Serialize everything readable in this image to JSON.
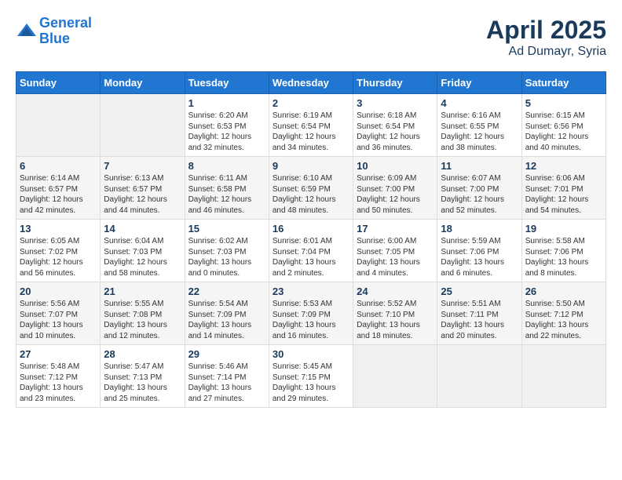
{
  "header": {
    "logo_line1": "General",
    "logo_line2": "Blue",
    "month": "April 2025",
    "location": "Ad Dumayr, Syria"
  },
  "days_of_week": [
    "Sunday",
    "Monday",
    "Tuesday",
    "Wednesday",
    "Thursday",
    "Friday",
    "Saturday"
  ],
  "weeks": [
    [
      {
        "day": null,
        "info": null
      },
      {
        "day": null,
        "info": null
      },
      {
        "day": "1",
        "info": "Sunrise: 6:20 AM\nSunset: 6:53 PM\nDaylight: 12 hours\nand 32 minutes."
      },
      {
        "day": "2",
        "info": "Sunrise: 6:19 AM\nSunset: 6:54 PM\nDaylight: 12 hours\nand 34 minutes."
      },
      {
        "day": "3",
        "info": "Sunrise: 6:18 AM\nSunset: 6:54 PM\nDaylight: 12 hours\nand 36 minutes."
      },
      {
        "day": "4",
        "info": "Sunrise: 6:16 AM\nSunset: 6:55 PM\nDaylight: 12 hours\nand 38 minutes."
      },
      {
        "day": "5",
        "info": "Sunrise: 6:15 AM\nSunset: 6:56 PM\nDaylight: 12 hours\nand 40 minutes."
      }
    ],
    [
      {
        "day": "6",
        "info": "Sunrise: 6:14 AM\nSunset: 6:57 PM\nDaylight: 12 hours\nand 42 minutes."
      },
      {
        "day": "7",
        "info": "Sunrise: 6:13 AM\nSunset: 6:57 PM\nDaylight: 12 hours\nand 44 minutes."
      },
      {
        "day": "8",
        "info": "Sunrise: 6:11 AM\nSunset: 6:58 PM\nDaylight: 12 hours\nand 46 minutes."
      },
      {
        "day": "9",
        "info": "Sunrise: 6:10 AM\nSunset: 6:59 PM\nDaylight: 12 hours\nand 48 minutes."
      },
      {
        "day": "10",
        "info": "Sunrise: 6:09 AM\nSunset: 7:00 PM\nDaylight: 12 hours\nand 50 minutes."
      },
      {
        "day": "11",
        "info": "Sunrise: 6:07 AM\nSunset: 7:00 PM\nDaylight: 12 hours\nand 52 minutes."
      },
      {
        "day": "12",
        "info": "Sunrise: 6:06 AM\nSunset: 7:01 PM\nDaylight: 12 hours\nand 54 minutes."
      }
    ],
    [
      {
        "day": "13",
        "info": "Sunrise: 6:05 AM\nSunset: 7:02 PM\nDaylight: 12 hours\nand 56 minutes."
      },
      {
        "day": "14",
        "info": "Sunrise: 6:04 AM\nSunset: 7:03 PM\nDaylight: 12 hours\nand 58 minutes."
      },
      {
        "day": "15",
        "info": "Sunrise: 6:02 AM\nSunset: 7:03 PM\nDaylight: 13 hours\nand 0 minutes."
      },
      {
        "day": "16",
        "info": "Sunrise: 6:01 AM\nSunset: 7:04 PM\nDaylight: 13 hours\nand 2 minutes."
      },
      {
        "day": "17",
        "info": "Sunrise: 6:00 AM\nSunset: 7:05 PM\nDaylight: 13 hours\nand 4 minutes."
      },
      {
        "day": "18",
        "info": "Sunrise: 5:59 AM\nSunset: 7:06 PM\nDaylight: 13 hours\nand 6 minutes."
      },
      {
        "day": "19",
        "info": "Sunrise: 5:58 AM\nSunset: 7:06 PM\nDaylight: 13 hours\nand 8 minutes."
      }
    ],
    [
      {
        "day": "20",
        "info": "Sunrise: 5:56 AM\nSunset: 7:07 PM\nDaylight: 13 hours\nand 10 minutes."
      },
      {
        "day": "21",
        "info": "Sunrise: 5:55 AM\nSunset: 7:08 PM\nDaylight: 13 hours\nand 12 minutes."
      },
      {
        "day": "22",
        "info": "Sunrise: 5:54 AM\nSunset: 7:09 PM\nDaylight: 13 hours\nand 14 minutes."
      },
      {
        "day": "23",
        "info": "Sunrise: 5:53 AM\nSunset: 7:09 PM\nDaylight: 13 hours\nand 16 minutes."
      },
      {
        "day": "24",
        "info": "Sunrise: 5:52 AM\nSunset: 7:10 PM\nDaylight: 13 hours\nand 18 minutes."
      },
      {
        "day": "25",
        "info": "Sunrise: 5:51 AM\nSunset: 7:11 PM\nDaylight: 13 hours\nand 20 minutes."
      },
      {
        "day": "26",
        "info": "Sunrise: 5:50 AM\nSunset: 7:12 PM\nDaylight: 13 hours\nand 22 minutes."
      }
    ],
    [
      {
        "day": "27",
        "info": "Sunrise: 5:48 AM\nSunset: 7:12 PM\nDaylight: 13 hours\nand 23 minutes."
      },
      {
        "day": "28",
        "info": "Sunrise: 5:47 AM\nSunset: 7:13 PM\nDaylight: 13 hours\nand 25 minutes."
      },
      {
        "day": "29",
        "info": "Sunrise: 5:46 AM\nSunset: 7:14 PM\nDaylight: 13 hours\nand 27 minutes."
      },
      {
        "day": "30",
        "info": "Sunrise: 5:45 AM\nSunset: 7:15 PM\nDaylight: 13 hours\nand 29 minutes."
      },
      {
        "day": null,
        "info": null
      },
      {
        "day": null,
        "info": null
      },
      {
        "day": null,
        "info": null
      }
    ]
  ]
}
